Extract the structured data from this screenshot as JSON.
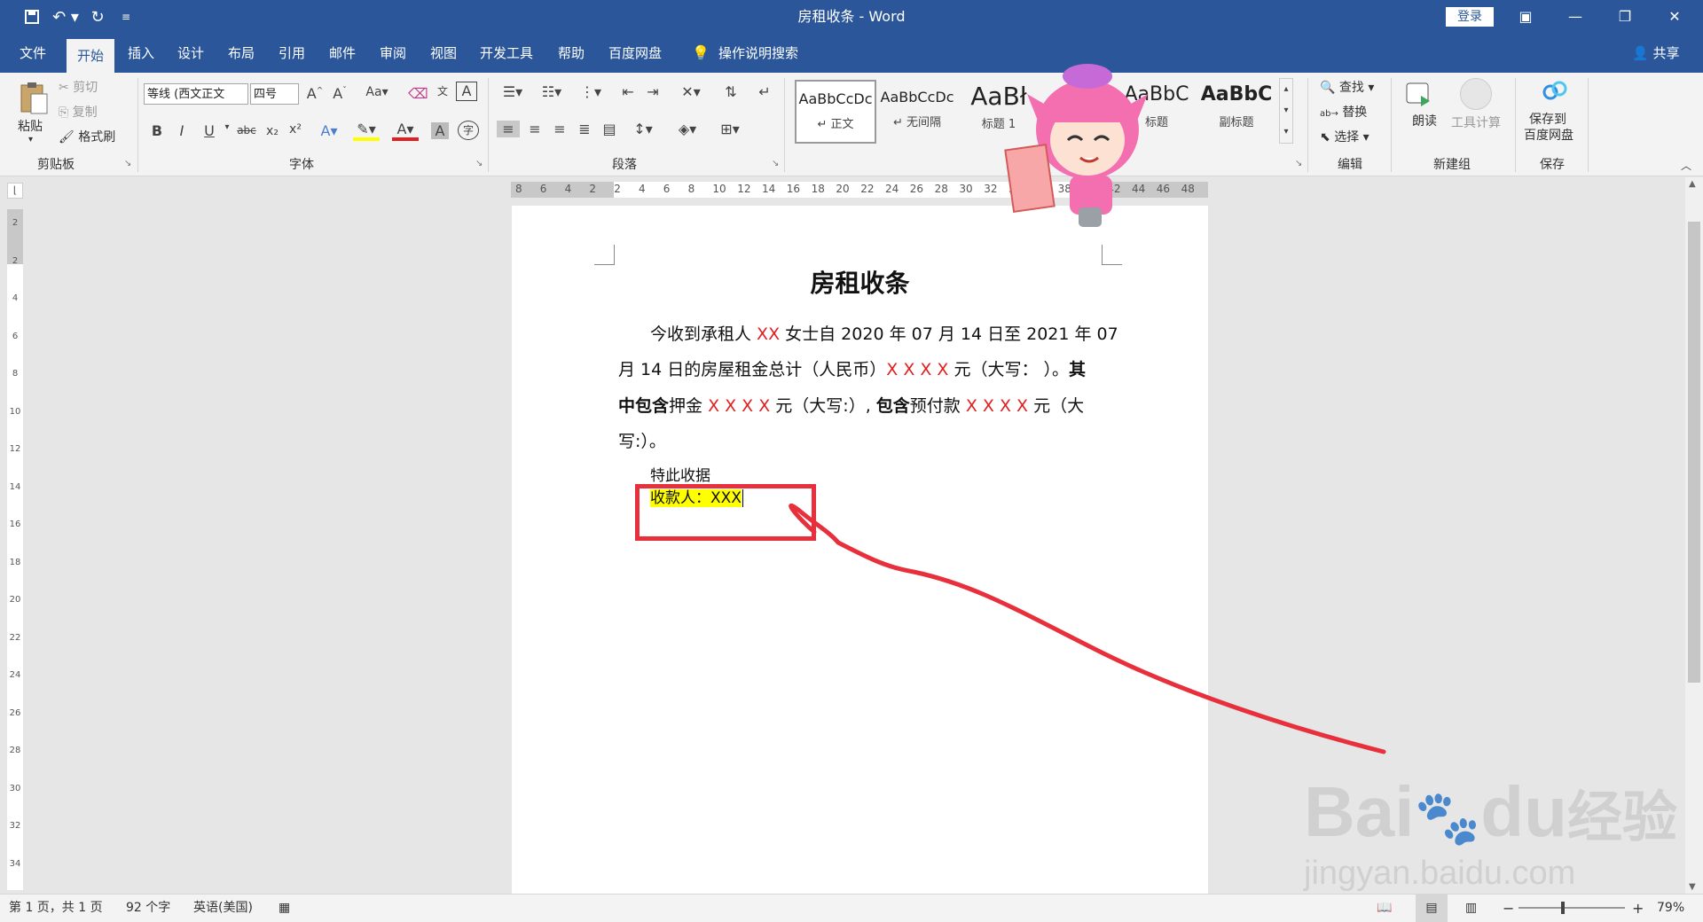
{
  "titlebar": {
    "title": "房租收条  -  Word",
    "login": "登录",
    "icons": [
      "save-icon",
      "undo-icon",
      "redo-icon",
      "customize-icon"
    ]
  },
  "menu": {
    "tabs": [
      "文件",
      "开始",
      "插入",
      "设计",
      "布局",
      "引用",
      "邮件",
      "审阅",
      "视图",
      "开发工具",
      "帮助",
      "百度网盘"
    ],
    "active": "开始",
    "tell_me": "操作说明搜索",
    "share": "共享"
  },
  "ribbon": {
    "clipboard": {
      "paste": "粘贴",
      "cut": "剪切",
      "copy": "复制",
      "format_painter": "格式刷",
      "label": "剪贴板"
    },
    "font": {
      "font_name": "等线 (西文正文",
      "font_size": "四号",
      "change_case": "Aa",
      "label": "字体"
    },
    "paragraph": {
      "label": "段落"
    },
    "styles": {
      "items": [
        {
          "sample": "AaBbCcDc",
          "name": "正文"
        },
        {
          "sample": "AaBbCcDc",
          "name": "无间隔"
        },
        {
          "sample": "AaBł",
          "name": "标题 1"
        },
        {
          "sample": "AaBbC",
          "name": "标题"
        },
        {
          "sample": "AaBbC",
          "name": "副标题"
        }
      ]
    },
    "editing": {
      "find": "查找",
      "replace": "替换",
      "select": "选择",
      "label": "编辑"
    },
    "new_group": {
      "read_aloud": "朗读",
      "tool_calc": "工具计算",
      "label": "新建组"
    },
    "save": {
      "save_to": "保存到",
      "baidu": "百度网盘",
      "label": "保存"
    }
  },
  "ruler": {
    "h_ticks": [
      "8",
      "6",
      "4",
      "2",
      "2",
      "4",
      "6",
      "8",
      "10",
      "12",
      "14",
      "16",
      "18",
      "20",
      "22",
      "24",
      "26",
      "28",
      "30",
      "32",
      "34",
      "36",
      "38",
      "40",
      "42",
      "44",
      "46",
      "48"
    ],
    "v_ticks": [
      "2",
      "2",
      "4",
      "6",
      "8",
      "10",
      "12",
      "14",
      "16",
      "18",
      "20",
      "22",
      "24",
      "26",
      "28",
      "30",
      "32",
      "34"
    ]
  },
  "document": {
    "title": "房租收条",
    "line1": {
      "a": "今收到承租人 ",
      "red1": "XX",
      "b": " 女士自 2020 年 07 月 14 日至 2021 年 07"
    },
    "line2": {
      "a": "月 14 日的房屋租金总计（人民币）",
      "red1": "X X X X",
      "b": " 元（大写：  ）。",
      "bold1": "其"
    },
    "line3": {
      "bold1": "中包含",
      "a": "押金 ",
      "red1": "X X X X",
      "b": " 元（大写:）, ",
      "bold2": "包含",
      "c": "预付款 ",
      "red2": "X X X X",
      "d": " 元（大"
    },
    "line4": "写:）。",
    "line5": "特此收据",
    "line6": "收款人：XXX"
  },
  "statusbar": {
    "page": "第 1 页，共 1 页",
    "words": "92 个字",
    "lang": "英语(美国)",
    "zoom": "79%",
    "zoom_minus": "−",
    "zoom_plus": "+"
  },
  "watermark": {
    "brand": "Bai",
    "brand2": "du",
    "cn": "经验",
    "url": "jingyan.baidu.com"
  }
}
